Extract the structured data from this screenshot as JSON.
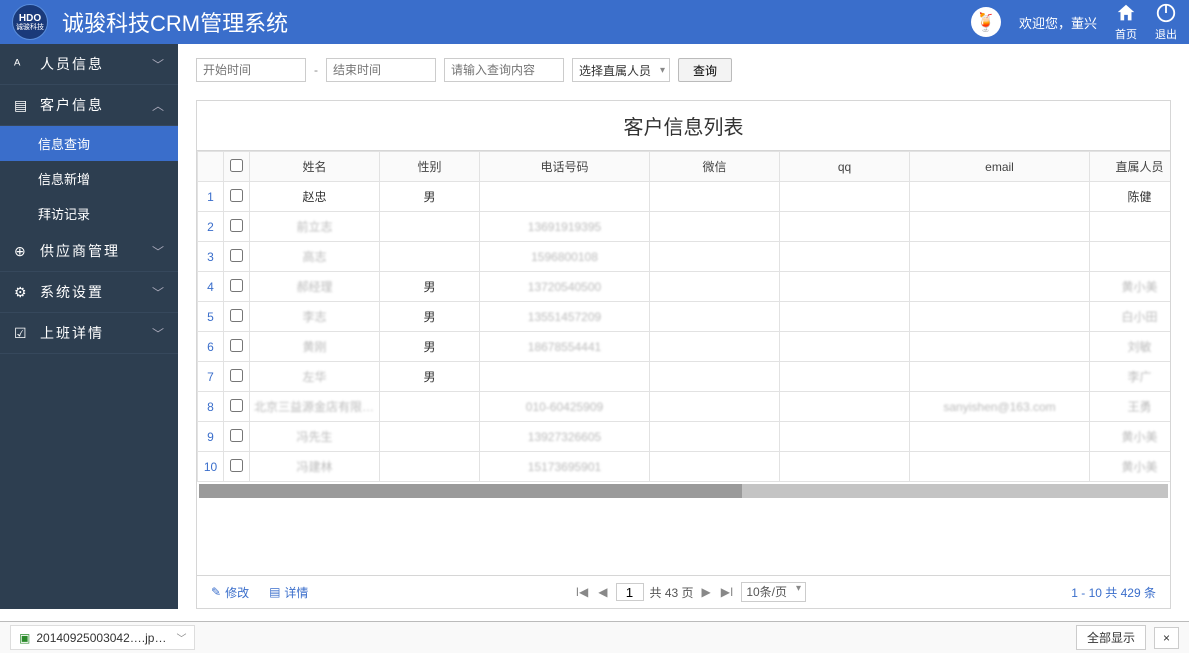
{
  "header": {
    "logo_top": "HDO",
    "logo_bottom": "诚骏科技",
    "title": "诚骏科技CRM管理系统",
    "welcome": "欢迎您，董兴",
    "home_label": "首页",
    "logout_label": "退出"
  },
  "sidebar": {
    "items": [
      {
        "icon": "person-icon",
        "label": "人员信息",
        "expanded": false
      },
      {
        "icon": "file-icon",
        "label": "客户信息",
        "expanded": true,
        "children": [
          "信息查询",
          "信息新增",
          "拜访记录"
        ],
        "active_child": 0
      },
      {
        "icon": "scan-icon",
        "label": "供应商管理",
        "expanded": false
      },
      {
        "icon": "gear-icon",
        "label": "系统设置",
        "expanded": false
      },
      {
        "icon": "chart-icon",
        "label": "上班详情",
        "expanded": false
      }
    ]
  },
  "filters": {
    "start_placeholder": "开始时间",
    "dash": "-",
    "end_placeholder": "结束时间",
    "search_placeholder": "请输入查询内容",
    "owner_select": "选择直属人员",
    "query_btn": "查询"
  },
  "table": {
    "title": "客户信息列表",
    "columns": [
      "",
      "",
      "姓名",
      "性别",
      "电话号码",
      "微信",
      "qq",
      "email",
      "直属人员"
    ],
    "rows": [
      {
        "idx": 1,
        "name": "赵忠",
        "gender": "男",
        "phone": "",
        "wechat": "",
        "qq": "",
        "email": "",
        "owner": "陈健",
        "blurred": false
      },
      {
        "idx": 2,
        "name": "前立志",
        "gender": "",
        "phone": "13691919395",
        "wechat": "",
        "qq": "",
        "email": "",
        "owner": "",
        "blurred": true
      },
      {
        "idx": 3,
        "name": "高志",
        "gender": "",
        "phone": "1596800108",
        "wechat": "",
        "qq": "",
        "email": "",
        "owner": "",
        "blurred": true
      },
      {
        "idx": 4,
        "name": "郝经理",
        "gender": "男",
        "phone": "13720540500",
        "wechat": "",
        "qq": "",
        "email": "",
        "owner": "黄小美",
        "blurred": true
      },
      {
        "idx": 5,
        "name": "李志",
        "gender": "男",
        "phone": "13551457209",
        "wechat": "",
        "qq": "",
        "email": "",
        "owner": "白小田",
        "blurred": true
      },
      {
        "idx": 6,
        "name": "黄刚",
        "gender": "男",
        "phone": "18678554441",
        "wechat": "",
        "qq": "",
        "email": "",
        "owner": "刘敏",
        "blurred": true
      },
      {
        "idx": 7,
        "name": "左华",
        "gender": "男",
        "phone": "",
        "wechat": "",
        "qq": "",
        "email": "",
        "owner": "李广",
        "blurred": true
      },
      {
        "idx": 8,
        "name": "北京三益源金店有限公…",
        "gender": "",
        "phone": "010-60425909",
        "wechat": "",
        "qq": "",
        "email": "sanyishen@163.com",
        "owner": "王勇",
        "blurred": true
      },
      {
        "idx": 9,
        "name": "冯先生",
        "gender": "",
        "phone": "13927326605",
        "wechat": "",
        "qq": "",
        "email": "",
        "owner": "黄小美",
        "blurred": true
      },
      {
        "idx": 10,
        "name": "冯建林",
        "gender": "",
        "phone": "15173695901",
        "wechat": "",
        "qq": "",
        "email": "",
        "owner": "黄小美",
        "blurred": true
      }
    ]
  },
  "footer": {
    "edit_label": "修改",
    "detail_label": "详情",
    "page_current": "1",
    "page_total_label": "共 43 页",
    "per_page": "10条/页",
    "count_label": "1 - 10  共 429 条"
  },
  "download_bar": {
    "file_name": "20140925003042….jp…",
    "show_all": "全部显示",
    "close": "×"
  }
}
